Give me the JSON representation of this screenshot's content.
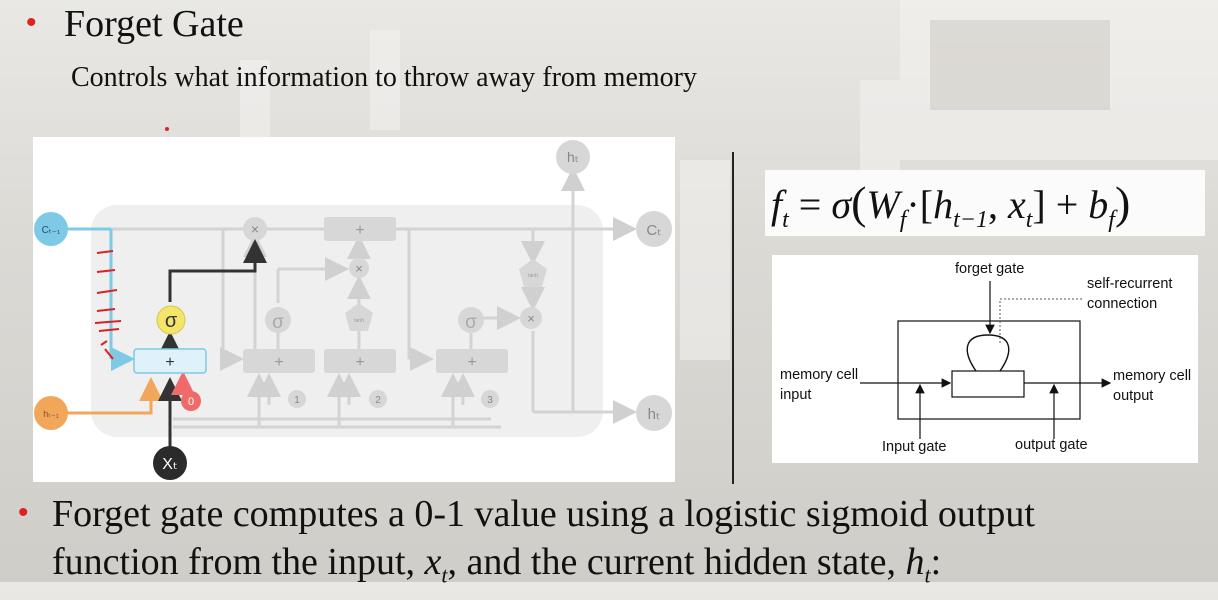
{
  "slide": {
    "bullet_symbol": "•",
    "title": "Forget Gate",
    "subtitle": "Controls what information to throw away from memory",
    "bottom_line1": "Forget gate computes a 0-1 value using a logistic sigmoid output",
    "bottom_line2_prefix": "function from the input, ",
    "bottom_line2_x": "x",
    "bottom_line2_x_sub": "t",
    "bottom_line2_middle": ", and the current hidden state, ",
    "bottom_line2_h": "h",
    "bottom_line2_h_sub": "t",
    "bottom_line2_suffix": ":"
  },
  "lstm_diagram": {
    "c_prev": "Cₜ₋₁",
    "h_prev": "hₜ₋₁",
    "x_t": "Xₜ",
    "c_t": "Cₜ",
    "h_t_top": "hₜ",
    "h_t_right": "hₜ",
    "sigma": "σ",
    "tanh": "tanh",
    "plus": "+",
    "times": "×",
    "bias_forget": "0",
    "bias_1": "1",
    "bias_2": "2",
    "bias_3": "3"
  },
  "equation": {
    "f": "f",
    "t": "t",
    "equals": " = ",
    "sigma": "σ",
    "W": "W",
    "bias_b": "b",
    "h": "h",
    "t_minus_1": "t−1",
    "x": "x",
    "open_paren": "(",
    "close_paren": ")",
    "open_bracket": "[",
    "close_bracket": "]",
    "dot": "·",
    "comma": ", ",
    "plus": " + "
  },
  "memory_cell": {
    "forget_gate": "forget gate",
    "self_recurrent_1": "self-recurrent",
    "self_recurrent_2": "connection",
    "input_1": "memory cell",
    "input_2": "input",
    "output_1": "memory cell",
    "output_2": "output",
    "input_gate": "Input gate",
    "output_gate": "output gate"
  },
  "colors": {
    "bullet": "#dd2222",
    "c_line": "#7ec9e6",
    "h_line": "#f2a65a",
    "x_node": "#2b2b2b",
    "sigma_fill": "#f4e46a",
    "bias_fill": "#ef6b6b",
    "faded": "#cfcfcf",
    "annotation_red": "#e02020"
  }
}
